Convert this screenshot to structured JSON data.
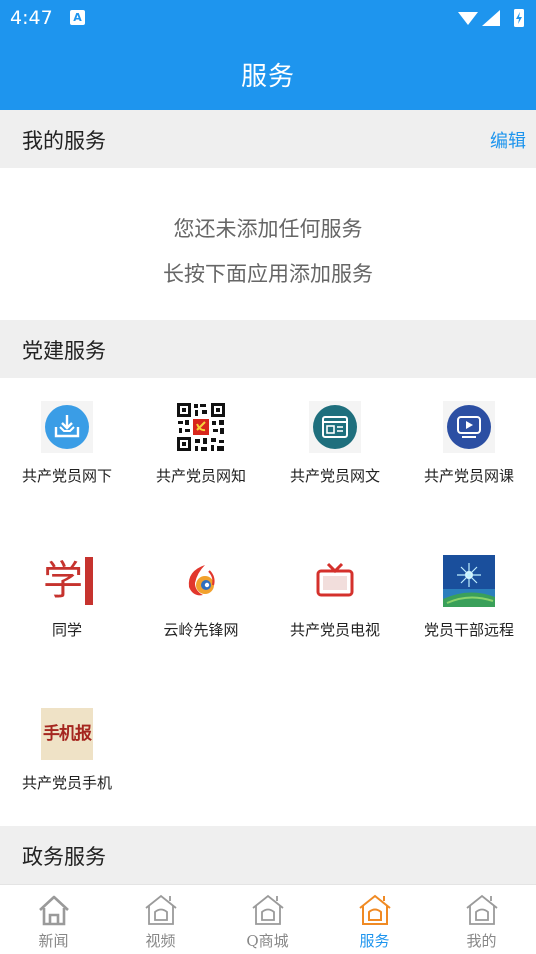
{
  "status_bar": {
    "time": "4:47",
    "notification_glyph": "A"
  },
  "header": {
    "title": "服务"
  },
  "my_services": {
    "title": "我的服务",
    "edit_label": "编辑",
    "empty_line1": "您还未添加任何服务",
    "empty_line2": "长按下面应用添加服务"
  },
  "party_services": {
    "title": "党建服务",
    "apps": [
      {
        "label": "共产党员网下",
        "icon": "download-tray-icon"
      },
      {
        "label": "共产党员网知",
        "icon": "qr-code-icon"
      },
      {
        "label": "共产党员网文",
        "icon": "article-icon"
      },
      {
        "label": "共产党员网课",
        "icon": "video-lesson-icon"
      },
      {
        "label": "同学",
        "icon": "tongxue-logo-icon",
        "logo_text": "学"
      },
      {
        "label": "云岭先锋网",
        "icon": "yunling-swirl-icon"
      },
      {
        "label": "共产党员电视",
        "icon": "tv-icon"
      },
      {
        "label": "党员干部远程",
        "icon": "remote-education-icon"
      },
      {
        "label": "共产党员手机",
        "icon": "mobile-newspaper-icon",
        "logo_text": "手机报"
      }
    ]
  },
  "gov_services": {
    "title": "政务服务"
  },
  "tab_bar": {
    "tabs": [
      {
        "label": "新闻",
        "icon": "home-icon",
        "active": false
      },
      {
        "label": "视频",
        "icon": "home-icon",
        "active": false
      },
      {
        "label": "Q商城",
        "icon": "home-icon",
        "active": false
      },
      {
        "label": "服务",
        "icon": "home-icon",
        "active": true
      },
      {
        "label": "我的",
        "icon": "home-icon",
        "active": false
      }
    ],
    "colors": {
      "active": "#1e95ee",
      "active_icon": "#f08a24",
      "inactive": "#888888"
    }
  },
  "colors": {
    "primary": "#1e95ee",
    "section_bg": "#efefef"
  }
}
